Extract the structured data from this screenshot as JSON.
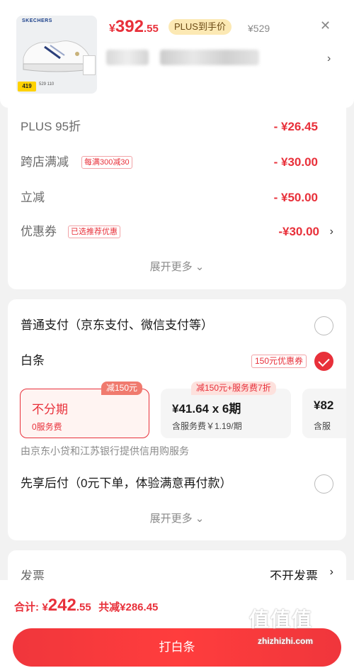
{
  "product": {
    "price_symbol": "¥",
    "price_int": "392",
    "price_dec": ".55",
    "plus_tag": "PLUS到手价",
    "original_price": "¥529",
    "thumb_brand": "SKECHERS",
    "thumb_price_badge": "419",
    "thumb_mini_prices": "529   110"
  },
  "discounts": {
    "rows": [
      {
        "label": "PLUS 95折",
        "value": "- ¥26.45"
      },
      {
        "label": "跨店满减",
        "tag": "每满300减30",
        "value": "- ¥30.00"
      },
      {
        "label": "立减",
        "value": "- ¥50.00"
      },
      {
        "label": "优惠券",
        "tag": "已选推荐优惠",
        "value": "-¥30.00"
      }
    ],
    "expand_more": "展开更多"
  },
  "payment": {
    "normal": "普通支付（京东支付、微信支付等）",
    "baitiao": "白条",
    "baitiao_coupon": "150元优惠券",
    "plans": [
      {
        "ribbon": "减150元",
        "title": "不分期",
        "sub": "0服务费"
      },
      {
        "ribbon": "减150元+服务费7折",
        "title": "¥41.64 x 6期",
        "sub": "含服务费￥1.19/期"
      },
      {
        "title": "¥82",
        "sub": "含服"
      }
    ],
    "provider": "由京东小贷和江苏银行提供信用购服务",
    "later": "先享后付（0元下单，体验满意再付款）",
    "expand_more": "展开更多"
  },
  "invoice": {
    "label": "发票",
    "value": "不开发票"
  },
  "footer": {
    "total_label": "合计:",
    "total_sym": "¥",
    "total_int": "242",
    "total_dec": ".55",
    "saved": "共减¥286.45",
    "cta": "打白条"
  },
  "watermark": {
    "main": "值值值",
    "sub": "zhizhizhi.com"
  },
  "colors": {
    "accent": "#e8303a",
    "plus_bg": "#fce9b4",
    "background": "#f2f2f2"
  },
  "icons": {
    "close": "close-icon",
    "chevron": "chevron-right-icon",
    "check": "check-icon"
  }
}
